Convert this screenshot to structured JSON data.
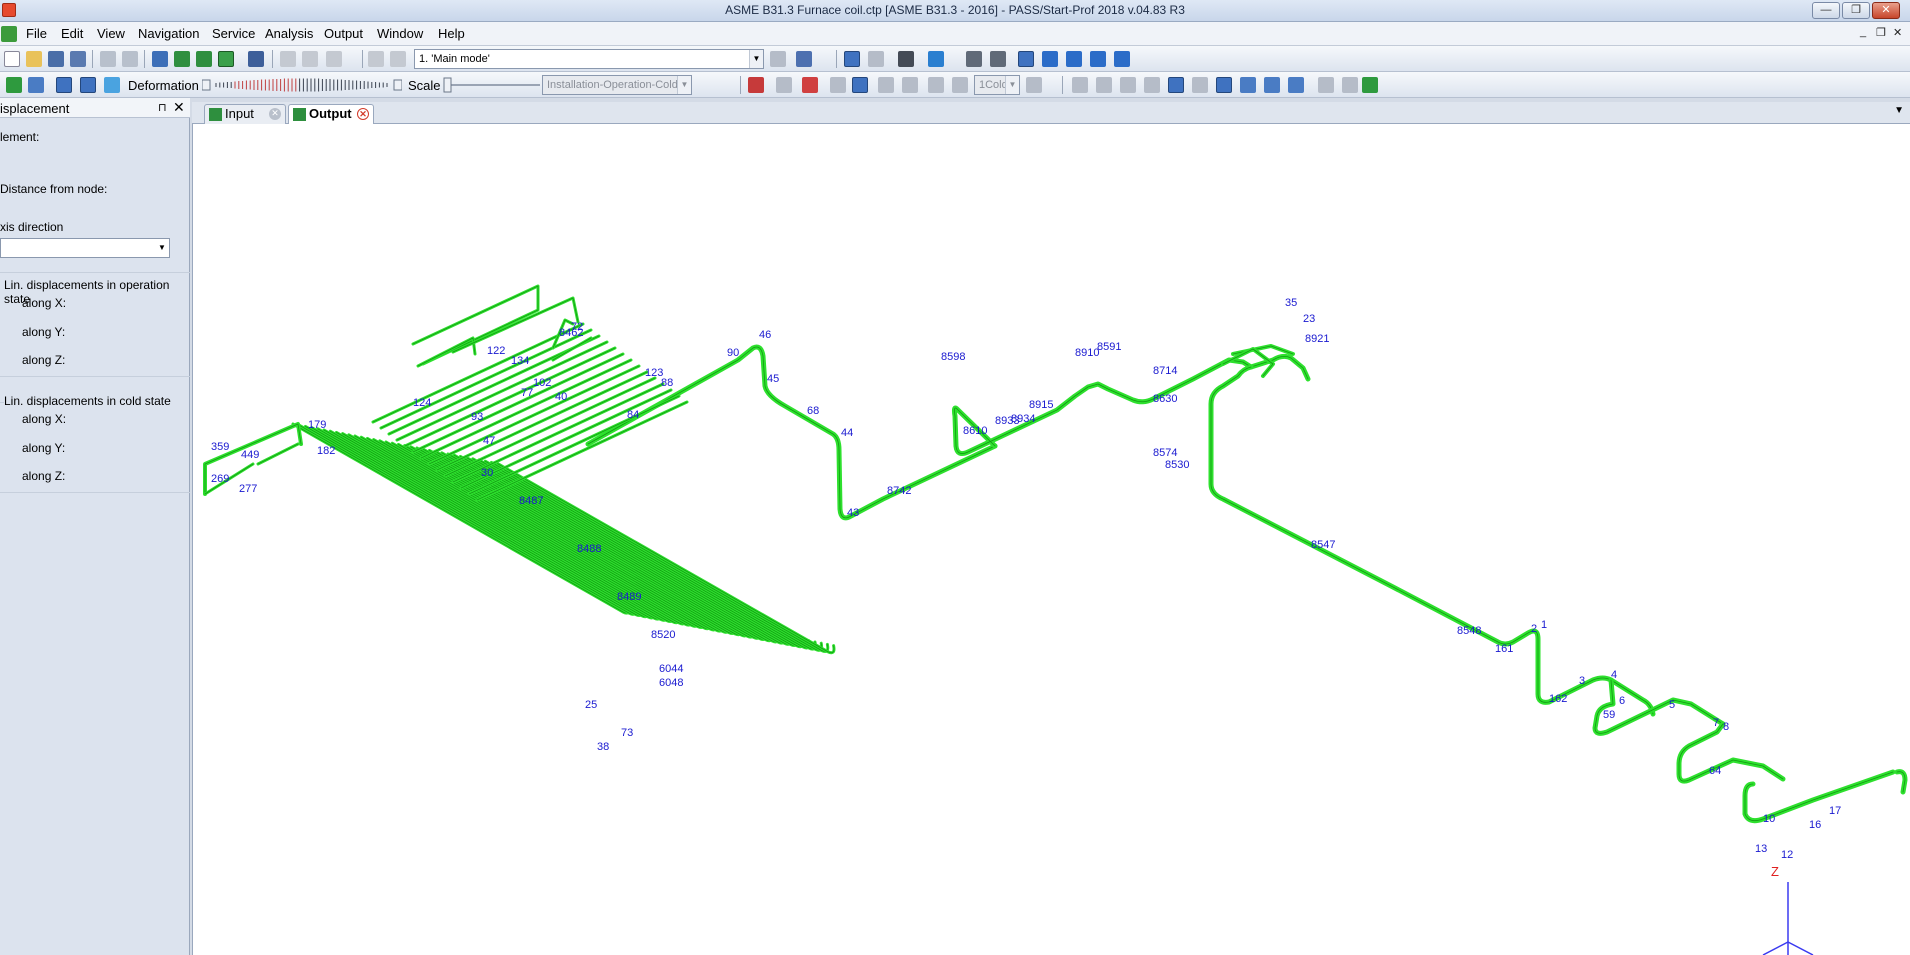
{
  "window": {
    "title": "ASME B31.3 Furnace coil.ctp [ASME B31.3 - 2016] - PASS/Start-Prof 2018 v.04.83 R3",
    "min_glyph": "—",
    "max_glyph": "❐",
    "close_glyph": "✕"
  },
  "menu": {
    "items": [
      "File",
      "Edit",
      "View",
      "Navigation",
      "Service",
      "Analysis",
      "Output",
      "Window",
      "Help"
    ],
    "mdi_min": "_",
    "mdi_restore": "❐",
    "mdi_close": "✕"
  },
  "toolbar1": {
    "mode_combo": "1. 'Main mode'"
  },
  "toolbar2": {
    "deformation_label": "Deformation",
    "scale_label": "Scale",
    "load_case_combo": "Installation-Operation-Cold",
    "cold_combo": "1Cold"
  },
  "side_panel": {
    "title": "isplacement",
    "pin": "⊓",
    "close": "✕",
    "element_label": "lement:",
    "distance_label": "Distance from node:",
    "axis_label": "xis direction",
    "op_header": "Lin. displacements in operation state",
    "op_x": "along X:",
    "op_y": "along Y:",
    "op_z": "along Z:",
    "cold_header": "Lin. displacements in cold state",
    "cold_x": "along X:",
    "cold_y": "along Y:",
    "cold_z": "along Z:"
  },
  "tabs": {
    "input": "Input",
    "output": "Output"
  },
  "view": {
    "axis_z": "Z",
    "node_labels": [
      {
        "t": "72"
      },
      {
        "t": "8462"
      },
      {
        "t": "122"
      },
      {
        "t": "134"
      },
      {
        "t": "102"
      },
      {
        "t": "77"
      },
      {
        "t": "40"
      },
      {
        "t": "123"
      },
      {
        "t": "84"
      },
      {
        "t": "88"
      },
      {
        "t": "90"
      },
      {
        "t": "46"
      },
      {
        "t": "45"
      },
      {
        "t": "68"
      },
      {
        "t": "44"
      },
      {
        "t": "43"
      },
      {
        "t": "8742"
      },
      {
        "t": "8598"
      },
      {
        "t": "8910"
      },
      {
        "t": "8591"
      },
      {
        "t": "8714"
      },
      {
        "t": "8630"
      },
      {
        "t": "8915"
      },
      {
        "t": "8610"
      },
      {
        "t": "8933"
      },
      {
        "t": "8934"
      },
      {
        "t": "35"
      },
      {
        "t": "23"
      },
      {
        "t": "8921"
      },
      {
        "t": "8574"
      },
      {
        "t": "8530"
      },
      {
        "t": "8547"
      },
      {
        "t": "8548"
      },
      {
        "t": "161"
      },
      {
        "t": "2"
      },
      {
        "t": "1"
      },
      {
        "t": "3"
      },
      {
        "t": "4"
      },
      {
        "t": "162"
      },
      {
        "t": "59"
      },
      {
        "t": "6"
      },
      {
        "t": "5"
      },
      {
        "t": "7"
      },
      {
        "t": "8"
      },
      {
        "t": "64"
      },
      {
        "t": "10"
      },
      {
        "t": "13"
      },
      {
        "t": "12"
      },
      {
        "t": "16"
      },
      {
        "t": "17"
      },
      {
        "t": "359"
      },
      {
        "t": "449"
      },
      {
        "t": "269"
      },
      {
        "t": "277"
      },
      {
        "t": "179"
      },
      {
        "t": "182"
      },
      {
        "t": "124"
      },
      {
        "t": "93"
      },
      {
        "t": "47"
      },
      {
        "t": "30"
      },
      {
        "t": "8487"
      },
      {
        "t": "8488"
      },
      {
        "t": "8489"
      },
      {
        "t": "8520"
      },
      {
        "t": "6044"
      },
      {
        "t": "6048"
      },
      {
        "t": "73"
      },
      {
        "t": "38"
      },
      {
        "t": "25"
      }
    ]
  }
}
